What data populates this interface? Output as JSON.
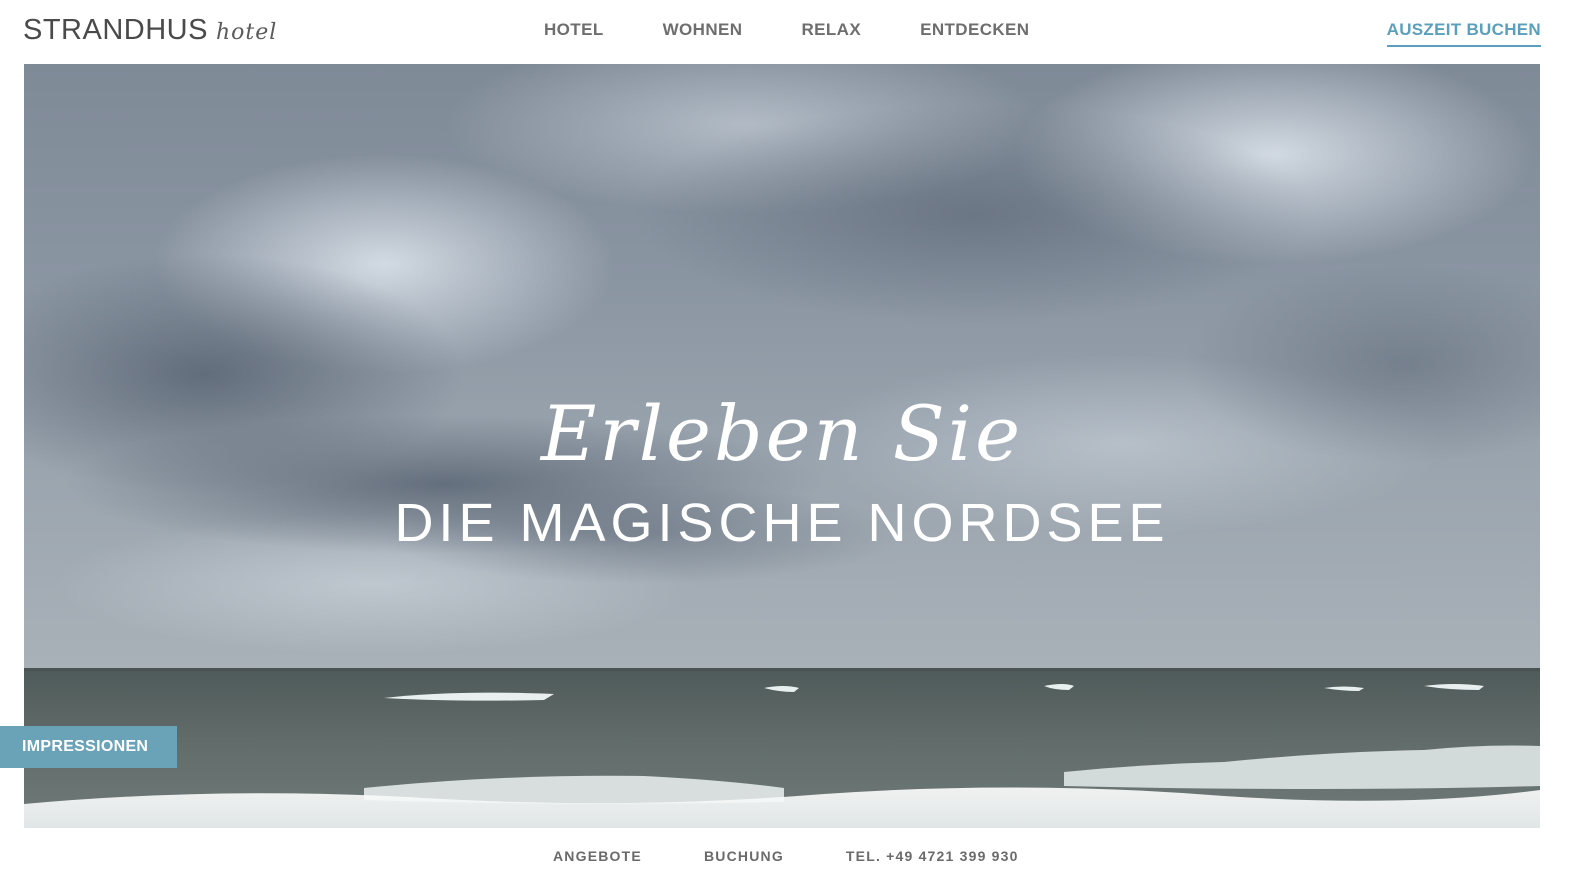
{
  "brand": {
    "name": "STRANDHUS",
    "subtitle": "hotel"
  },
  "nav": {
    "items": [
      {
        "label": "HOTEL"
      },
      {
        "label": "WOHNEN"
      },
      {
        "label": "RELAX"
      },
      {
        "label": "ENTDECKEN"
      }
    ],
    "cta_label": "AUSZEIT BUCHEN"
  },
  "hero": {
    "script_text": "Erleben Sie",
    "title": "DIE MAGISCHE NORDSEE",
    "impressions_label": "IMPRESSIONEN"
  },
  "footer": {
    "links": [
      {
        "label": "ANGEBOTE"
      },
      {
        "label": "BUCHUNG"
      },
      {
        "label": "TEL. +49 4721 399 930"
      }
    ]
  },
  "colors": {
    "accent": "#5aa0bd",
    "impressions_bg": "#6aa2b8",
    "nav_text": "#6e6e6e",
    "sky_dark": "#6f7a86",
    "sky_light": "#c9d2dc",
    "sea": "#5f6a68"
  }
}
